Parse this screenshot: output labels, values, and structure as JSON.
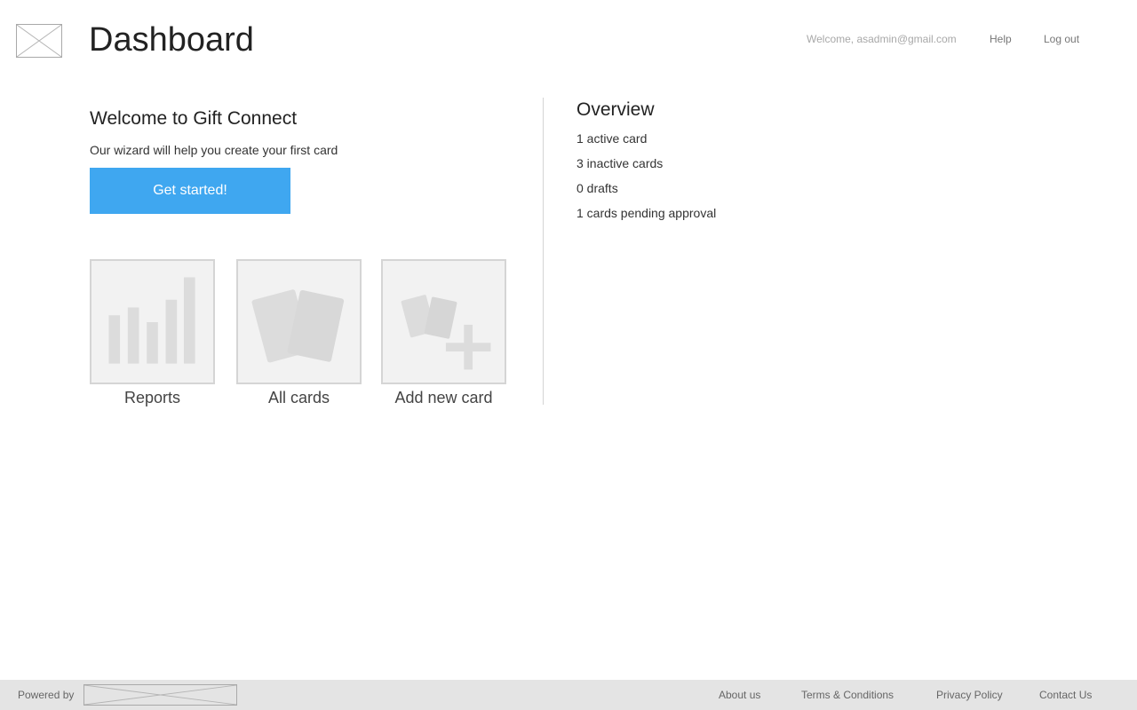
{
  "header": {
    "title": "Dashboard",
    "welcome": "Welcome, asadmin@gmail.com",
    "help": "Help",
    "logout": "Log out"
  },
  "intro": {
    "heading": "Welcome to Gift Connect",
    "subtitle": "Our wizard will help you create your first card",
    "cta_label": "Get started!",
    "cta_color": "#3fa7f0"
  },
  "tiles": [
    {
      "label": "Reports",
      "icon": "bar-chart-icon"
    },
    {
      "label": "All cards",
      "icon": "cards-icon"
    },
    {
      "label": "Add new card",
      "icon": "add-card-icon"
    }
  ],
  "overview": {
    "heading": "Overview",
    "items": [
      "1 active card",
      "3 inactive cards",
      "0 drafts",
      "1 cards pending approval"
    ]
  },
  "footer": {
    "powered_by": "Powered by",
    "links": [
      "About us",
      "Terms & Conditions",
      "Privacy Policy",
      "Contact Us"
    ]
  }
}
